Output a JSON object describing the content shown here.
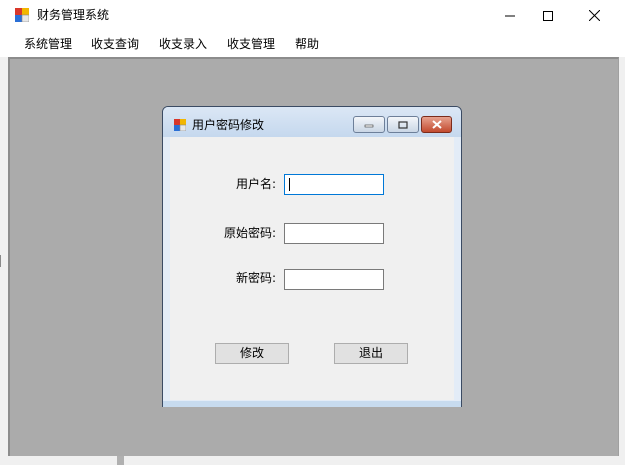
{
  "window": {
    "title": "财务管理系统"
  },
  "menu": {
    "items": [
      "系统管理",
      "收支查询",
      "收支录入",
      "收支管理",
      "帮助"
    ]
  },
  "dialog": {
    "title": "用户密码修改",
    "username_label": "用户名:",
    "old_password_label": "原始密码:",
    "new_password_label": "新密码:",
    "username_value": "",
    "old_password_value": "",
    "new_password_value": "",
    "modify_button": "修改",
    "exit_button": "退出"
  }
}
